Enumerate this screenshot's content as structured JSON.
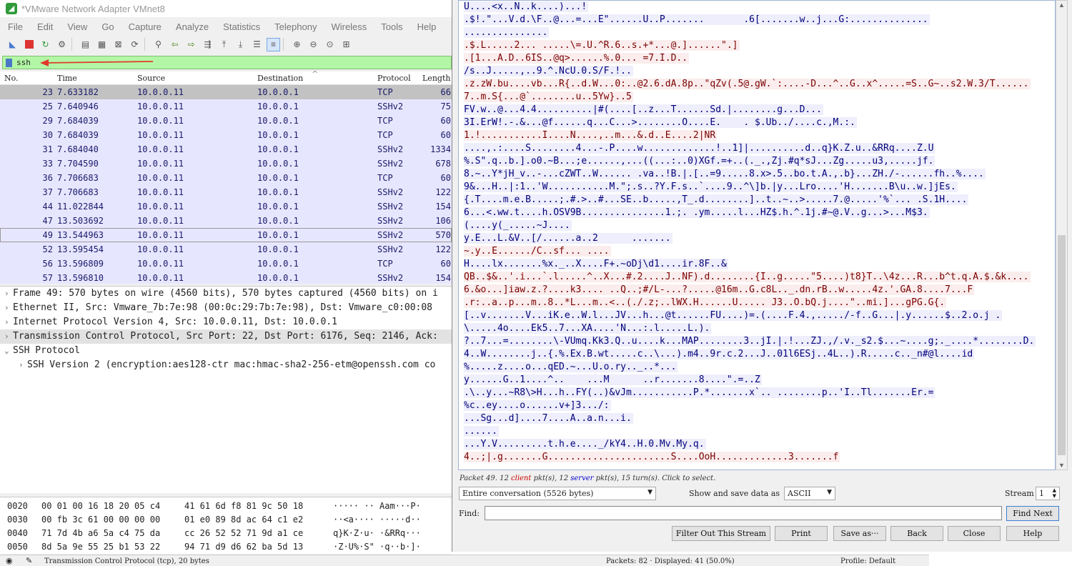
{
  "window": {
    "title": "*VMware Network Adapter VMnet8"
  },
  "menu": [
    "File",
    "Edit",
    "View",
    "Go",
    "Capture",
    "Analyze",
    "Statistics",
    "Telephony",
    "Wireless",
    "Tools",
    "Help"
  ],
  "toolbar_icons": [
    "shark-fin-icon",
    "stop-icon",
    "restart-icon",
    "options-icon",
    "open-icon",
    "save-icon",
    "close-file-icon",
    "reload-icon",
    "find-icon",
    "back-icon",
    "forward-icon",
    "goto-icon",
    "first-icon",
    "last-icon",
    "autoscroll-icon",
    "colorize-icon",
    "zoom-in-icon",
    "zoom-out-icon",
    "zoom-normal-icon",
    "resize-columns-icon"
  ],
  "filter": {
    "value": "ssh"
  },
  "packet_list": {
    "columns": [
      "No.",
      "Time",
      "Source",
      "Destination",
      "Protocol",
      "Length"
    ],
    "rows": [
      {
        "no": "23",
        "time": "7.633182",
        "src": "10.0.0.11",
        "dst": "10.0.0.1",
        "proto": "TCP",
        "len": "66"
      },
      {
        "no": "25",
        "time": "7.640946",
        "src": "10.0.0.11",
        "dst": "10.0.0.1",
        "proto": "SSHv2",
        "len": "75"
      },
      {
        "no": "29",
        "time": "7.684039",
        "src": "10.0.0.11",
        "dst": "10.0.0.1",
        "proto": "TCP",
        "len": "60"
      },
      {
        "no": "30",
        "time": "7.684039",
        "src": "10.0.0.11",
        "dst": "10.0.0.1",
        "proto": "TCP",
        "len": "60"
      },
      {
        "no": "31",
        "time": "7.684040",
        "src": "10.0.0.11",
        "dst": "10.0.0.1",
        "proto": "SSHv2",
        "len": "1334"
      },
      {
        "no": "33",
        "time": "7.704590",
        "src": "10.0.0.11",
        "dst": "10.0.0.1",
        "proto": "SSHv2",
        "len": "678"
      },
      {
        "no": "36",
        "time": "7.706683",
        "src": "10.0.0.11",
        "dst": "10.0.0.1",
        "proto": "TCP",
        "len": "60"
      },
      {
        "no": "37",
        "time": "7.706683",
        "src": "10.0.0.11",
        "dst": "10.0.0.1",
        "proto": "SSHv2",
        "len": "122"
      },
      {
        "no": "44",
        "time": "11.022844",
        "src": "10.0.0.11",
        "dst": "10.0.0.1",
        "proto": "SSHv2",
        "len": "154"
      },
      {
        "no": "47",
        "time": "13.503692",
        "src": "10.0.0.11",
        "dst": "10.0.0.1",
        "proto": "SSHv2",
        "len": "106"
      },
      {
        "no": "49",
        "time": "13.544963",
        "src": "10.0.0.11",
        "dst": "10.0.0.1",
        "proto": "SSHv2",
        "len": "570"
      },
      {
        "no": "52",
        "time": "13.595454",
        "src": "10.0.0.11",
        "dst": "10.0.0.1",
        "proto": "SSHv2",
        "len": "122"
      },
      {
        "no": "56",
        "time": "13.596809",
        "src": "10.0.0.11",
        "dst": "10.0.0.1",
        "proto": "TCP",
        "len": "60"
      },
      {
        "no": "57",
        "time": "13.596810",
        "src": "10.0.0.11",
        "dst": "10.0.0.1",
        "proto": "SSHv2",
        "len": "154"
      }
    ]
  },
  "details": [
    {
      "arrow": "›",
      "text": "Frame 49: 570 bytes on wire (4560 bits), 570 bytes captured (4560 bits) on i"
    },
    {
      "arrow": "›",
      "text": "Ethernet II, Src: Vmware_7b:7e:98 (00:0c:29:7b:7e:98), Dst: Vmware_c0:00:08"
    },
    {
      "arrow": "›",
      "text": "Internet Protocol Version 4, Src: 10.0.0.11, Dst: 10.0.0.1"
    },
    {
      "arrow": "›",
      "text": "Transmission Control Protocol, Src Port: 22, Dst Port: 6176, Seq: 2146, Ack:"
    },
    {
      "arrow": "⌄",
      "text": "SSH Protocol"
    },
    {
      "arrow": "›",
      "text": "SSH Version 2 (encryption:aes128-ctr mac:hmac-sha2-256-etm@openssh.com co"
    }
  ],
  "hex": [
    {
      "off": "0020",
      "a": "00 01 00 16 18 20 05 c4",
      "b": "41 61 6d f8 81 9c 50 18",
      "asc": "····· ·· Aam···P·"
    },
    {
      "off": "0030",
      "a": "00 fb 3c 61 00 00 00 00",
      "b": "01 e0 89 8d ac 64 c1 e2",
      "asc": "··<a···· ·····d··"
    },
    {
      "off": "0040",
      "a": "71 7d 4b a6 5a c4 75 da",
      "b": "cc 26 52 52 71 9d a1 ce",
      "asc": "q}K·Z·u· ·&RRq···"
    },
    {
      "off": "0050",
      "a": "8d 5a 9e 55 25 b1 53 22",
      "b": "94 71 d9 d6 62 ba 5d 13",
      "asc": "·Z·U%·S\" ·q··b·]·"
    }
  ],
  "status": {
    "left": "Transmission Control Protocol (tcp), 20 bytes",
    "packets": "Packets: 82 · Displayed: 41 (50.0%)",
    "profile": "Profile: Default"
  },
  "follow": {
    "lines": [
      {
        "dir": "server",
        "text": "U....<x..N..k....)...!"
      },
      {
        "dir": "server",
        "text": ".$!.\"...V.d.\\F..@...=...E\"......U..P.......       .6[.......w..j...G:.............."
      },
      {
        "dir": "server",
        "text": "..............."
      },
      {
        "dir": "client",
        "text": ".$.L.....2... .....\\=.U.^R.6..s.+*...@.]......\".]"
      },
      {
        "dir": "client",
        "text": ".[1...A.D..6IS..@q>......%.0... =7.I.D.."
      },
      {
        "dir": "server",
        "text": "/s..J.....,..9.^.NcU.0.S/F.!.."
      },
      {
        "dir": "client",
        "text": ".z.zW.bu....vb...R{..d.W...0:..@2.6.dA.8p..\"qZv(.5@.gW.`:....-D...^..G..x^.....=S..G~..s2.W.3/T......"
      },
      {
        "dir": "client",
        "text": "7..m.S{...@`........u..5Yw}..5"
      },
      {
        "dir": "server",
        "text": "FV.w..@...4.4..........|#(....[..z...T......Sd.|........g...D..."
      },
      {
        "dir": "server",
        "text": "3I.ErW!.-.&...@f......q...C...>........O....E.    . $.Ub../....c.,M.:."
      },
      {
        "dir": "client",
        "text": "1.!...........I....N....,..m...&.d..E....2|NR"
      },
      {
        "dir": "server",
        "text": "....,.:....S........4...-.P....w.............!..1]|..........d..q}K.Z.u..&RRq....Z.U"
      },
      {
        "dir": "server",
        "text": "%.S\".q..b.].o0.~B...;e......,...((...:..0)XGf.=+..(._.,Zj.#q*sJ...Zg.....u3,.....jf."
      },
      {
        "dir": "server",
        "text": "8.~..Y*jH_v..-...cZWT..W...... .va..!B.|.[..=9.....8.x>.5..bo.t.A.,.b}...ZH./-......fh..%...."
      },
      {
        "dir": "server",
        "text": "9&...H..|:1..'W...........M.\";.s..?Y.F.s..`....9..^\\]b.|y...Lro....'H.......B\\u..w.]jEs."
      },
      {
        "dir": "server",
        "text": "{.T....m.e.B.....;.#.>..#...SE..b.....,T_.d........]..t..~..>.....7.@.....'%`... .S.1H...."
      },
      {
        "dir": "server",
        "text": "6...<.ww.t....h.OSV9B...............1.;. .ym.....l...HZ$.h.^.1j.#~@.V..g...>...M$3."
      },
      {
        "dir": "server",
        "text": "(....y(_.....~J...."
      },
      {
        "dir": "server",
        "text": "y.E...L.&V..[/......a..2      ......."
      },
      {
        "dir": "client",
        "text": "~.y..E....../C..sf... ...."
      },
      {
        "dir": "server",
        "text": "H....lx.......%x._..X....F+.~oDj\\d1....ir.8F..&"
      },
      {
        "dir": "client",
        "text": "QB..$&..'.i...`.l.....^..X...#.2....J..NF).d........{I..g.....\"5....)t8}T..\\4z...R...b^t.q.A.$.&k...."
      },
      {
        "dir": "client",
        "text": "6.&o...]iaw.z.?....k3.... ..Q..;#/L-...?.....@16m..G.c8L.._.dn.rB..w.....4z.'.GA.8....7...F"
      },
      {
        "dir": "client",
        "text": ".r:..a..p...m..8..*L...m..<..(./.z;..lWX.H......U..... J3..O.bQ.j....\"..mi.]...gPG.G{."
      },
      {
        "dir": "server",
        "text": "[..v.......V...iK.e..W.l...JV...h...@t......FU....)=.(....F.4.,...../-f..G...|.y......$..2.o.j ."
      },
      {
        "dir": "server",
        "text": "\\.....4o....Ek5..7...XA....'N...:.l.....L.)."
      },
      {
        "dir": "server",
        "text": "?..7...=........\\-VUmq.Kk3.Q..u....k...MAP........3..jI.|.!...ZJ.,/.v._s2.$...~....g;._....*........D."
      },
      {
        "dir": "server",
        "text": "4..W........j..{.%.Ex.B.wt.....c..\\...).m4..9r.c.2...J..01l6ESj..4L..).R.....c.._n#@l....id"
      },
      {
        "dir": "server",
        "text": "%.....z....o...qED.~...U.o.ry.._..*..."
      },
      {
        "dir": "server",
        "text": "y......G..1....^..    ...M      ..r.......8....\".=..Z"
      },
      {
        "dir": "server",
        "text": ".\\..y...~R8\\>H...h..FY(..)&vJm...........P.*.......x`.. ........p..'I..Tl.......Er.="
      },
      {
        "dir": "server",
        "text": "%c..ey....o......v+]3.../:"
      },
      {
        "dir": "server",
        "text": "...Sg...d]....7....A..a.n...i."
      },
      {
        "dir": "server",
        "text": "......"
      },
      {
        "dir": "server",
        "text": "...Y.V.........t.h.e...._/kY4..H.0.Mv.My.q."
      },
      {
        "dir": "client",
        "text": "4..;|.g.......G......................S....OoH.............3.......f"
      }
    ],
    "info_prefix": "Packet 49. 12 ",
    "info_client": "client",
    "info_mid": " pkt(s), 12 ",
    "info_server": "server",
    "info_suffix": " pkt(s), 15 turn(s). Click to select.",
    "conversation": "Entire conversation (5526 bytes)",
    "show_label": "Show and save data as",
    "format": "ASCII",
    "stream_label": "Stream",
    "stream": "1",
    "find_label": "Find:",
    "find_value": "",
    "buttons": {
      "find_next": "Find Next",
      "filter_out": "Filter Out This Stream",
      "print": "Print",
      "save_as": "Save as···",
      "back": "Back",
      "close": "Close",
      "help": "Help"
    }
  },
  "colors": {
    "filter_bg": "#b3f7a6",
    "client_bg": "#fbeded",
    "client_fg": "#7a0000",
    "server_bg": "#eeeefc",
    "server_fg": "#00007a"
  }
}
